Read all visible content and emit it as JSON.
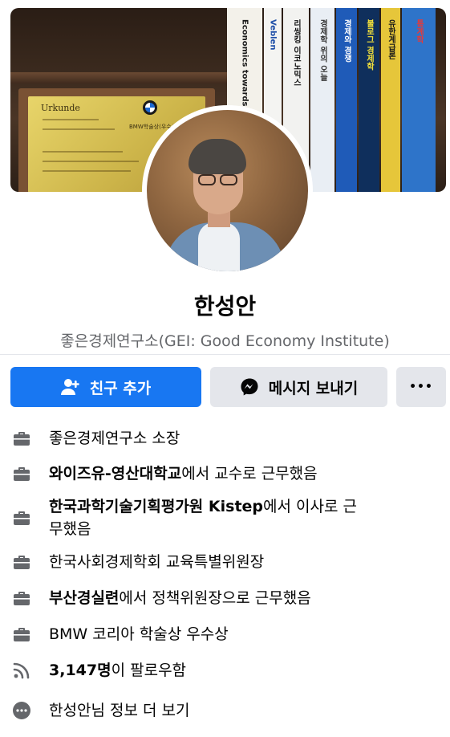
{
  "cover": {
    "plaque": {
      "title": "Urkunde",
      "subtitle": "BMW학술상(우수상)"
    },
    "books": [
      {
        "title": "Economics towards",
        "bg": "#f3f1ea",
        "color": "#1a1a1a"
      },
      {
        "title": "Veblen",
        "bg": "#f4f4f2",
        "color": "#1f4fa8"
      },
      {
        "title": "리씽킹 이코노믹스",
        "bg": "#f2f2f0",
        "color": "#111111"
      },
      {
        "title": "경제학 위의 오늘",
        "bg": "#e9eef4",
        "color": "#333333"
      },
      {
        "title": "경제와 경쟁",
        "bg": "#1f5bb8",
        "color": "#ffffff"
      },
      {
        "title": "불로그 경제학",
        "bg": "#0f2f5c",
        "color": "#f5e23a"
      },
      {
        "title": "유한계급론",
        "bg": "#e6c63a",
        "color": "#1a1a1a"
      },
      {
        "title": "통계학",
        "bg": "#2e74c9",
        "color": "#e33b3b"
      }
    ]
  },
  "profile": {
    "name": "한성안",
    "subtitle": "좋은경제연구소(GEI: Good Economy Institute)"
  },
  "actions": {
    "add_friend": "친구 추가",
    "message": "메시지 보내기",
    "more": "•••"
  },
  "info": [
    {
      "icon": "briefcase-icon",
      "bold": "",
      "text": "좋은경제연구소 소장"
    },
    {
      "icon": "briefcase-icon",
      "bold": "와이즈유-영산대학교",
      "text": "에서 교수로 근무했음"
    },
    {
      "icon": "briefcase-icon",
      "bold": "한국과학기술기획평가원 Kistep",
      "text": "에서 이사로 근무했음"
    },
    {
      "icon": "briefcase-icon",
      "bold": "",
      "text": "한국사회경제학회 교육특별위원장"
    },
    {
      "icon": "briefcase-icon",
      "bold": "부산경실련",
      "text": "에서 정책위원장으로 근무했음"
    },
    {
      "icon": "briefcase-icon",
      "bold": "",
      "text": "BMW 코리아 학술상 우수상"
    },
    {
      "icon": "rss-icon",
      "bold": "3,147명",
      "text": "이 팔로우함"
    },
    {
      "icon": "more-dots-icon",
      "bold": "",
      "text": "한성안님 정보 더 보기"
    }
  ],
  "colors": {
    "primary": "#1877f2",
    "secondary_button": "#e4e6eb",
    "text": "#050505",
    "muted": "#65676b"
  }
}
